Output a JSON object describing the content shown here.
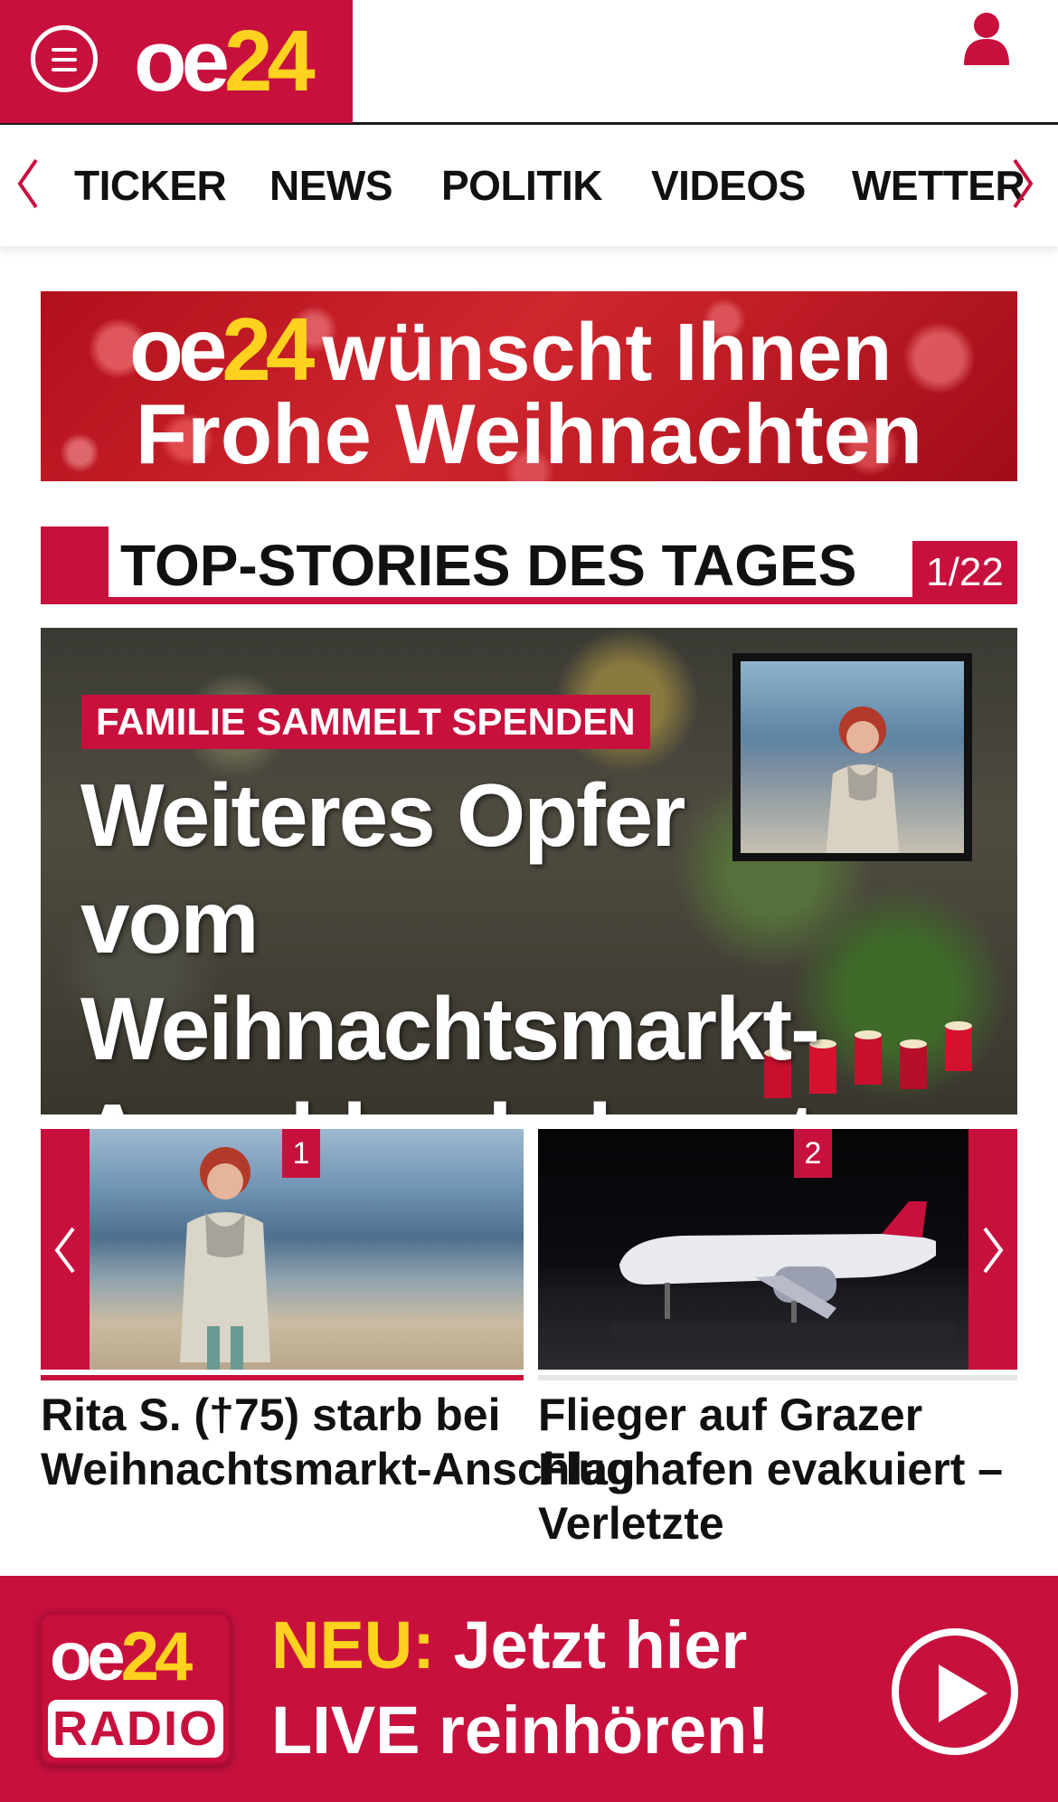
{
  "header": {
    "logo_oe": "oe",
    "logo_24": "24",
    "menu_icon": "hamburger-menu-icon",
    "user_icon": "user-profile-icon"
  },
  "nav": {
    "items": [
      {
        "label": "TICKER"
      },
      {
        "label": "NEWS"
      },
      {
        "label": "POLITIK"
      },
      {
        "label": "VIDEOS"
      },
      {
        "label": "WETTER"
      }
    ]
  },
  "xmas_banner": {
    "logo_oe": "oe",
    "logo_24": "24",
    "line1": "wünscht Ihnen",
    "line2": "Frohe Weihnachten"
  },
  "top_stories": {
    "title": "TOP-STORIES DES TAGES",
    "counter": "1/22"
  },
  "hero": {
    "kicker": "FAMILIE SAMMELT SPENDEN",
    "headline": "Weiteres Opfer vom Weihnachtsmarkt-Anschlag bekannt"
  },
  "carousel": {
    "cards": [
      {
        "num": "1",
        "title_line1": "Rita S. (†75) starb bei",
        "title_line2": "Weihnachtsmarkt-Anschlag",
        "title_line3": ""
      },
      {
        "num": "2",
        "title_line1": "Flieger auf Grazer",
        "title_line2": "Flughafen evakuiert –",
        "title_line3": "Verletzte"
      }
    ]
  },
  "radio_banner": {
    "logo_oe": "oe",
    "logo_24": "24",
    "logo_radio": "RADIO",
    "neu": "NEU:",
    "line1_rest": "Jetzt hier",
    "line2": "LIVE reinhören!"
  },
  "colors": {
    "brand_red": "#c8103d",
    "brand_yellow": "#ffd21f"
  }
}
